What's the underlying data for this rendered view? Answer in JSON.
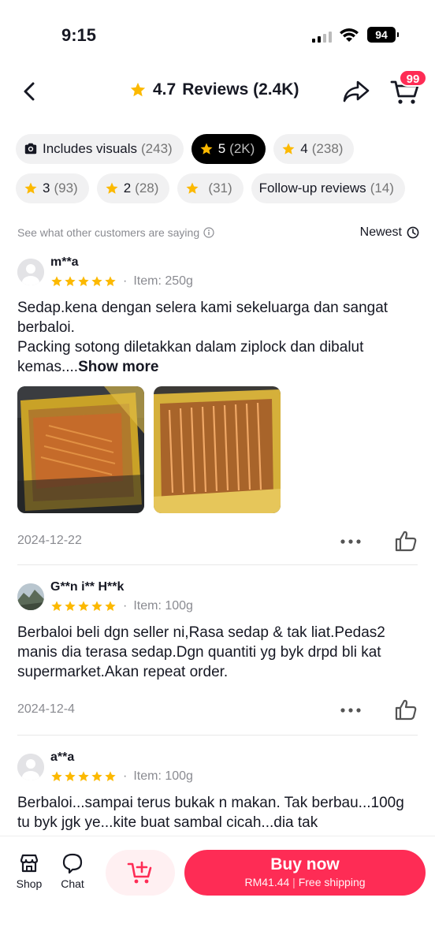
{
  "status_bar": {
    "time": "9:15",
    "battery": "94"
  },
  "header": {
    "rating": "4.7",
    "title": "Reviews (2.4K)",
    "cart_badge": "99"
  },
  "filters": {
    "row1": [
      {
        "label": "Includes visuals",
        "count": "(243)",
        "icon": "camera-icon",
        "active": false
      },
      {
        "label": "5",
        "count": "(2K)",
        "icon": "star-icon",
        "active": true
      },
      {
        "label": "4",
        "count": "(238)",
        "icon": "star-icon",
        "active": false
      }
    ],
    "row2": [
      {
        "label": "3",
        "count": "(93)",
        "icon": "star-icon",
        "active": false
      },
      {
        "label": "2",
        "count": "(28)",
        "icon": "star-icon",
        "active": false
      },
      {
        "label": "",
        "count": "(31)",
        "icon": "star-icon",
        "active": false
      },
      {
        "label": "Follow-up reviews",
        "count": "(14)",
        "icon": "",
        "active": false
      }
    ]
  },
  "sort": {
    "hint": "See what other customers are saying",
    "label": "Newest"
  },
  "reviews": [
    {
      "user": "m**a",
      "rating": 5,
      "item": "Item: 250g",
      "text": "Sedap.kena dengan selera kami sekeluarga dan sangat berbaloi.",
      "text2": "Packing sotong diletakkan dalam ziplock dan dibalut kemas....",
      "show_more": "Show more",
      "date": "2024-12-22"
    },
    {
      "user": "G**n i** H**k",
      "rating": 5,
      "item": "Item: 100g",
      "text": "Berbaloi beli dgn seller ni,Rasa sedap & tak liat.Pedas2 manis dia terasa sedap.Dgn quantiti yg byk drpd bli kat supermarket.Akan repeat order.",
      "date": "2024-12-4"
    },
    {
      "user": "a**a",
      "rating": 5,
      "item": "Item: 100g",
      "text": "Berbaloi...sampai terus bukak n makan. Tak berbau...100g tu byk jgk ye...kite buat sambal cicah...dia tak"
    }
  ],
  "bottom_bar": {
    "shop": "Shop",
    "chat": "Chat",
    "buy_now": "Buy now",
    "price": "RM41.44",
    "separator": "|",
    "shipping": "Free shipping"
  },
  "colors": {
    "accent": "#fe2c55",
    "star": "#fcb900"
  }
}
